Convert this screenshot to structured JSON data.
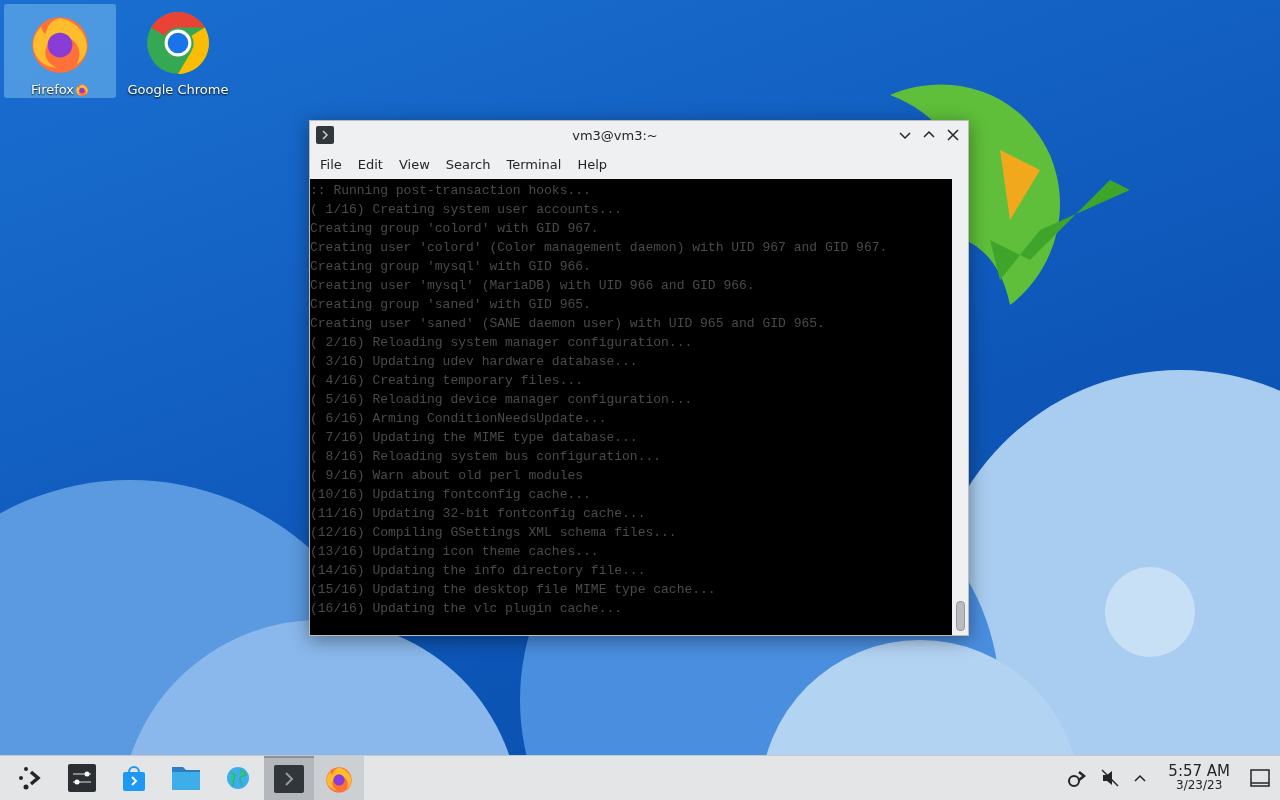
{
  "desktop_icons": [
    {
      "kind": "firefox",
      "label": "Firefox",
      "selected": true,
      "badge": true
    },
    {
      "kind": "chrome",
      "label": "Google Chrome",
      "selected": false,
      "badge": false
    }
  ],
  "terminal": {
    "title": "vm3@vm3:~",
    "active": true,
    "menu": [
      "File",
      "Edit",
      "View",
      "Search",
      "Terminal",
      "Help"
    ],
    "lines": [
      ":: Running post-transaction hooks...",
      "( 1/16) Creating system user accounts...",
      "Creating group 'colord' with GID 967.",
      "Creating user 'colord' (Color management daemon) with UID 967 and GID 967.",
      "Creating group 'mysql' with GID 966.",
      "Creating user 'mysql' (MariaDB) with UID 966 and GID 966.",
      "Creating group 'saned' with GID 965.",
      "Creating user 'saned' (SANE daemon user) with UID 965 and GID 965.",
      "( 2/16) Reloading system manager configuration...",
      "( 3/16) Updating udev hardware database...",
      "( 4/16) Creating temporary files...",
      "( 5/16) Reloading device manager configuration...",
      "( 6/16) Arming ConditionNeedsUpdate...",
      "( 7/16) Updating the MIME type database...",
      "( 8/16) Reloading system bus configuration...",
      "( 9/16) Warn about old perl modules",
      "(10/16) Updating fontconfig cache...",
      "(11/16) Updating 32-bit fontconfig cache...",
      "(12/16) Compiling GSettings XML schema files...",
      "(13/16) Updating icon theme caches...",
      "(14/16) Updating the info directory file...",
      "(15/16) Updating the desktop file MIME type cache...",
      "(16/16) Updating the vlc plugin cache..."
    ]
  },
  "taskbar": {
    "launchers": [
      {
        "kind": "menu"
      },
      {
        "kind": "settings"
      },
      {
        "kind": "store"
      },
      {
        "kind": "folder"
      },
      {
        "kind": "globe"
      }
    ],
    "tasks": [
      {
        "kind": "terminal",
        "active": true
      },
      {
        "kind": "firefox",
        "active": false
      }
    ],
    "tray": {
      "muted": true
    },
    "clock": {
      "time": "5:57 AM",
      "date": "3/23/23"
    }
  }
}
